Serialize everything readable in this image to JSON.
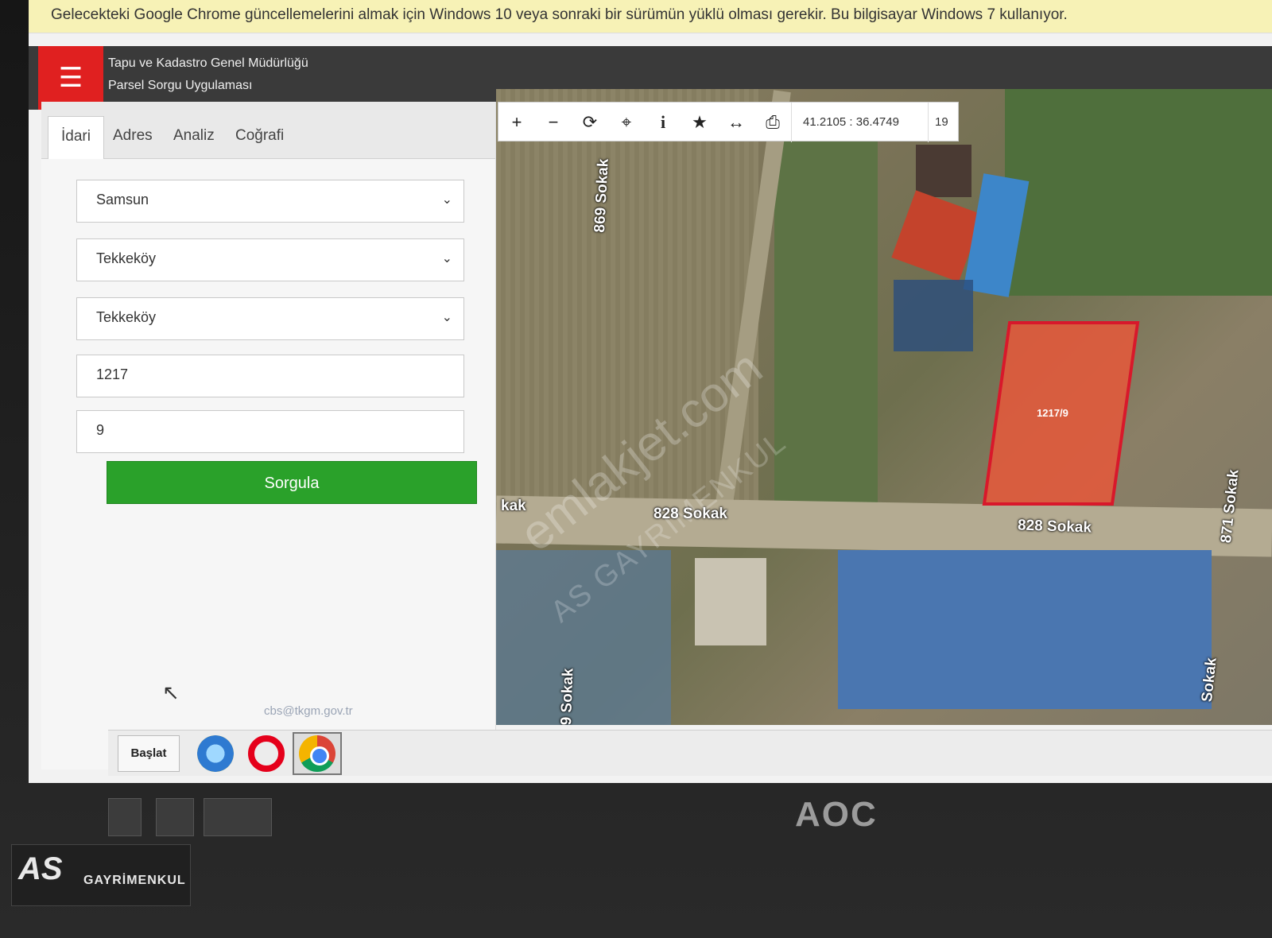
{
  "browser": {
    "infobar_text": "Gelecekteki Google Chrome güncellemelerini almak için Windows 10 veya sonraki bir sürümün yüklü olması gerekir. Bu bilgisayar Windows 7 kullanıyor."
  },
  "header": {
    "menu_icon": "hamburger-icon",
    "org_title": "Tapu ve Kadastro Genel Müdürlüğü",
    "app_title": "Parsel Sorgu Uygulaması",
    "accent_color": "#e02020"
  },
  "tabs": [
    {
      "label": "İdari",
      "active": true
    },
    {
      "label": "Adres",
      "active": false
    },
    {
      "label": "Analiz",
      "active": false
    },
    {
      "label": "Coğrafi",
      "active": false
    }
  ],
  "form": {
    "il": "Samsun",
    "ilce": "Tekkeköy",
    "mahalle": "Tekkeköy",
    "ada": "1217",
    "parsel": "9",
    "submit_label": "Sorgula",
    "submit_color": "#2aa12a"
  },
  "footer": {
    "email": "cbs@tkgm.gov.tr"
  },
  "toolbar": {
    "tools": [
      "zoom-in-icon",
      "zoom-out-icon",
      "refresh-icon",
      "locate-icon",
      "info-icon",
      "favorite-icon",
      "measure-icon",
      "print-icon"
    ],
    "coordinates": "41.2105 : 36.4749",
    "zoom_level": "19"
  },
  "map": {
    "streets": {
      "s869": "869 Sokak",
      "s828_left": "828 Sokak",
      "s828_right": "828 Sokak",
      "s871": "871 Sokak",
      "partial_left": "kak",
      "partial_bottom": "9 Sokak",
      "partial_right": "Sokak"
    },
    "parcel_label": "1217/9",
    "parcel_color": "#d8182b",
    "watermark_1": "emlakjet.com",
    "watermark_2": "AS GAYRİMENKUL"
  },
  "taskbar": {
    "start_label": "Başlat",
    "apps": [
      "internet-explorer-icon",
      "opera-icon",
      "chrome-icon"
    ]
  },
  "monitor": {
    "brand": "AOC"
  },
  "watermark_brand": {
    "logo_text": "AS",
    "name": "GAYRİMENKUL"
  }
}
